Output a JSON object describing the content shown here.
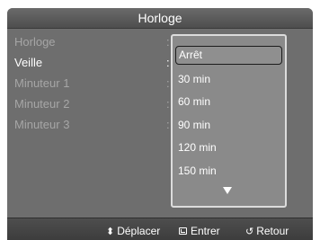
{
  "header": {
    "title": "Horloge"
  },
  "menu": {
    "items": [
      {
        "label": "Horloge",
        "active": false
      },
      {
        "label": "Veille",
        "active": true
      },
      {
        "label": "Minuteur 1",
        "active": false
      },
      {
        "label": "Minuteur 2",
        "active": false
      },
      {
        "label": "Minuteur 3",
        "active": false
      }
    ],
    "separator": ":"
  },
  "dropdown": {
    "selected": "Arrêt",
    "options": [
      "Arrêt",
      "30 min",
      "60 min",
      "90 min",
      "120 min",
      "150 min"
    ]
  },
  "footer": {
    "move": {
      "icon": "up-down-arrows-icon",
      "label": "Déplacer"
    },
    "enter": {
      "icon": "enter-icon",
      "label": "Entrer"
    },
    "back": {
      "icon": "return-icon",
      "label": "Retour"
    }
  },
  "colors": {
    "panel": "#6e6e6e",
    "title_bar": "#5a5a5a",
    "footer": "#434343",
    "dropdown_bg": "#8a8a8a",
    "dropdown_border": "#dcdcdc",
    "inactive_text": "#a6a6a6",
    "active_text": "#ffffff"
  }
}
